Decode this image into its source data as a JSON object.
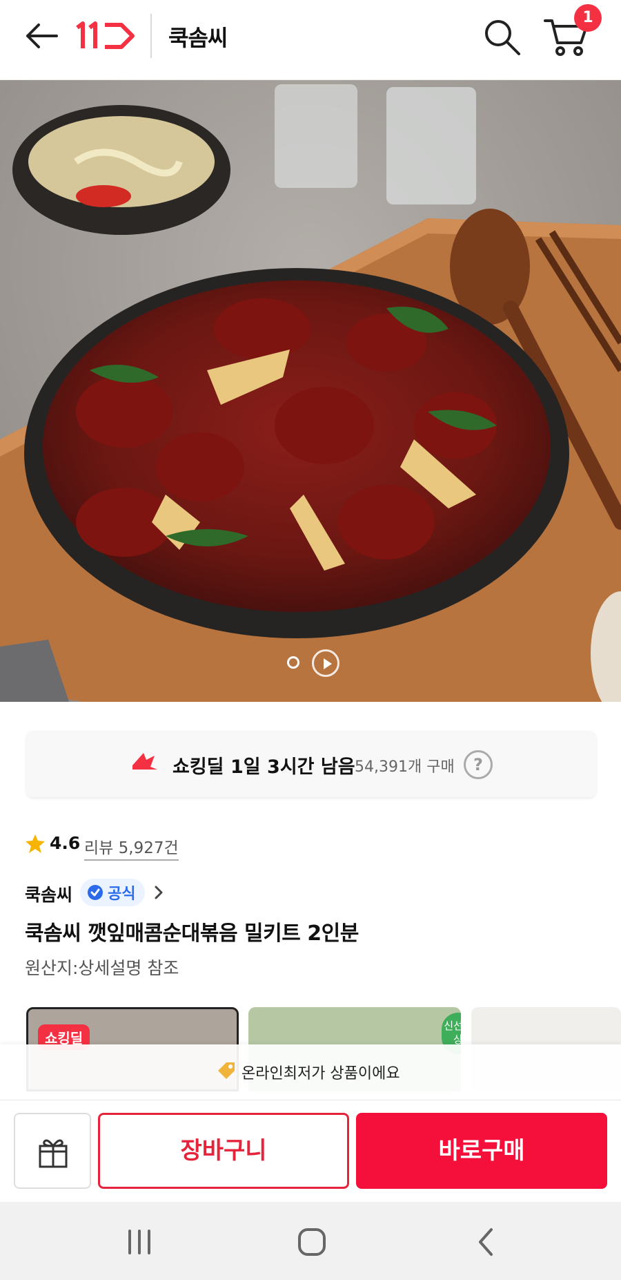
{
  "header": {
    "back_icon": "arrow-left-icon",
    "logo_text": "11",
    "store_title": "쿡솜씨",
    "search_icon": "search-icon",
    "cart_icon": "cart-icon",
    "cart_count": "1"
  },
  "hero": {
    "image_description": "product-photo",
    "carousel_icons": [
      "dot-icon",
      "play-icon"
    ]
  },
  "deal": {
    "icon": "shocking-deal-icon",
    "title": "쇼킹딜",
    "time_left": "1일 3시간 남음",
    "purchase_count": "54,391개 구매",
    "help": "?"
  },
  "rating": {
    "score": "4.6",
    "reviews": "리뷰 5,927건"
  },
  "seller": {
    "name": "쿡솜씨",
    "official_label": "공식"
  },
  "product": {
    "name": "쿡솜씨 깻잎매콤순대볶음 밀키트 2인분",
    "origin": "원산지:상세설명 참조"
  },
  "thumbnails": [
    {
      "badge": "쇼킹딜"
    },
    {
      "badge": "신선밥상"
    },
    {
      "badge": ""
    }
  ],
  "notice": {
    "text": "온라인최저가 상품이에요"
  },
  "actions": {
    "cart_label": "장바구니",
    "buy_label": "바로구매"
  },
  "colors": {
    "brand": "#f43142",
    "buy_button": "#f5103c",
    "official_blue": "#2b6bea"
  }
}
